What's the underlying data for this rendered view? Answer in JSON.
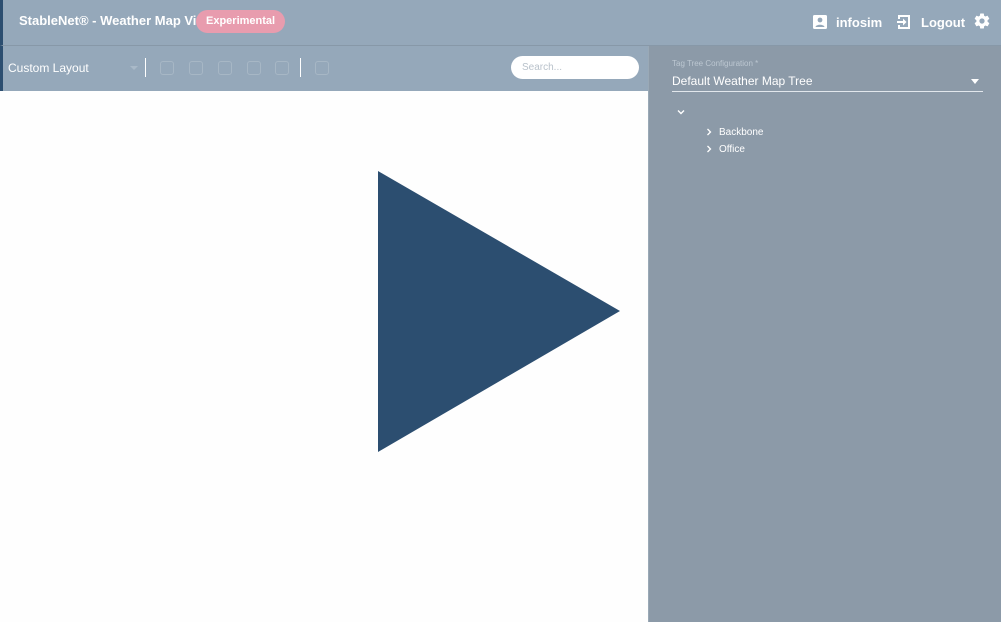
{
  "header": {
    "app_title": "StableNet® - Weather Map View",
    "badge": "Experimental",
    "user": {
      "name": "infosim",
      "icon": "account-box-icon"
    },
    "logout": {
      "label": "Logout",
      "icon": "logout-icon"
    },
    "settings_icon": "gear-icon"
  },
  "toolbar": {
    "layout_select": {
      "value": "Custom Layout"
    },
    "search": {
      "placeholder": "Search..."
    }
  },
  "canvas": {
    "loading_indicator": "play-triangle-icon",
    "colors": {
      "triangle": "#2c4e70",
      "background": "#fefefe"
    }
  },
  "side_panel": {
    "config_label": "Tag Tree Configuration *",
    "config_value": "Default Weather Map Tree",
    "tree": {
      "items": [
        {
          "label": "Backbone"
        },
        {
          "label": "Office"
        }
      ]
    }
  },
  "colors": {
    "header_bg": "#95a8ba",
    "accent": "#2c4e70",
    "badge_bg": "#e89cae",
    "panel_bg": "#8c9aa8"
  }
}
